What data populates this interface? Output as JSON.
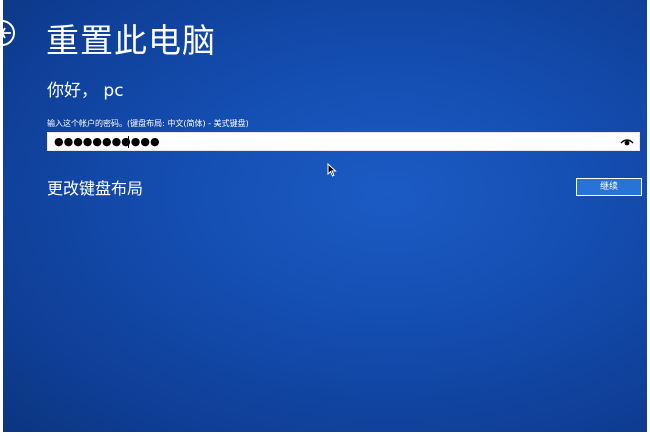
{
  "header": {
    "title": "重置此电脑"
  },
  "account": {
    "greeting": "你好， pc"
  },
  "password": {
    "prompt": "输入这个帐户的密码。(键盘布局: 中文(简体) - 美式键盘)",
    "masked_value": "●●●●●●●●●●●",
    "reveal_icon": "eye-icon"
  },
  "actions": {
    "change_keyboard_layout": "更改键盘布局",
    "continue_label": "继续"
  },
  "colors": {
    "background": "#154fb3",
    "text": "#ffffff",
    "button_fill": "#2a73d6"
  }
}
